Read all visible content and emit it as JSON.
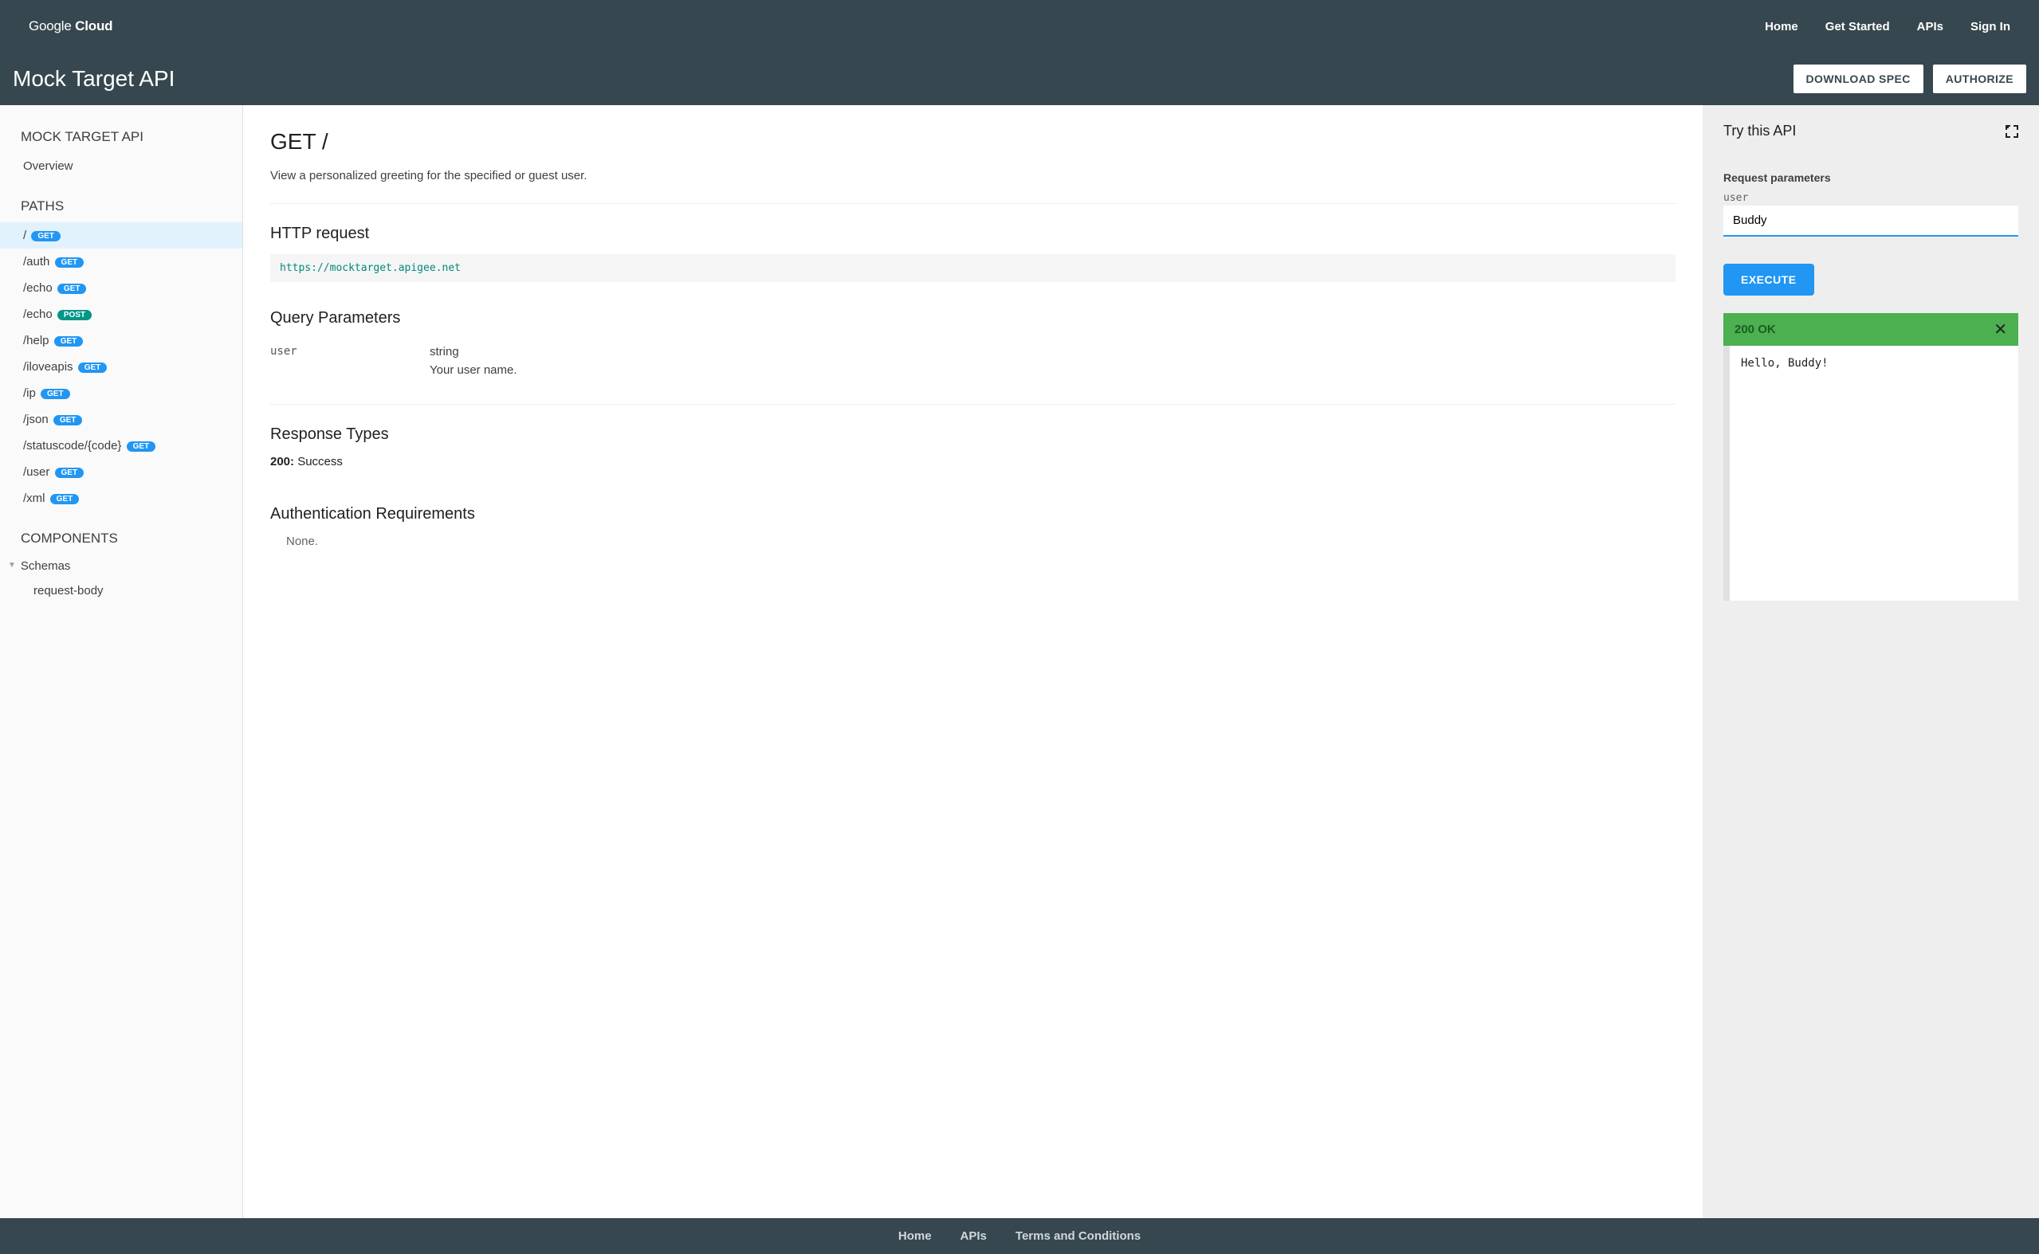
{
  "topnav": {
    "logo_part1": "Google ",
    "logo_part2": "Cloud",
    "links": [
      "Home",
      "Get Started",
      "APIs",
      "Sign In"
    ]
  },
  "subheader": {
    "title": "Mock Target API",
    "download": "DOWNLOAD SPEC",
    "authorize": "AUTHORIZE"
  },
  "sidebar": {
    "api_title": "MOCK TARGET API",
    "overview": "Overview",
    "paths_title": "PATHS",
    "paths": [
      {
        "path": "/",
        "method": "GET",
        "selected": true
      },
      {
        "path": "/auth",
        "method": "GET"
      },
      {
        "path": "/echo",
        "method": "GET"
      },
      {
        "path": "/echo",
        "method": "POST"
      },
      {
        "path": "/help",
        "method": "GET"
      },
      {
        "path": "/iloveapis",
        "method": "GET"
      },
      {
        "path": "/ip",
        "method": "GET"
      },
      {
        "path": "/json",
        "method": "GET"
      },
      {
        "path": "/statuscode/{code}",
        "method": "GET"
      },
      {
        "path": "/user",
        "method": "GET"
      },
      {
        "path": "/xml",
        "method": "GET"
      }
    ],
    "components_title": "COMPONENTS",
    "schemas_label": "Schemas",
    "schema_item": "request-body"
  },
  "content": {
    "title": "GET /",
    "description": "View a personalized greeting for the specified or guest user.",
    "http_request_h": "HTTP request",
    "http_url": "https://mocktarget.apigee.net",
    "query_params_h": "Query Parameters",
    "param": {
      "name": "user",
      "type": "string",
      "desc": "Your user name."
    },
    "response_types_h": "Response Types",
    "resp_code": "200:",
    "resp_text": " Success",
    "auth_h": "Authentication Requirements",
    "auth_none": "None."
  },
  "right": {
    "try_title": "Try this API",
    "req_params": "Request parameters",
    "field_label": "user",
    "field_value": "Buddy",
    "execute": "EXECUTE",
    "status": "200 OK",
    "body": "Hello, Buddy!"
  },
  "footer": {
    "links": [
      "Home",
      "APIs",
      "Terms and Conditions"
    ]
  }
}
